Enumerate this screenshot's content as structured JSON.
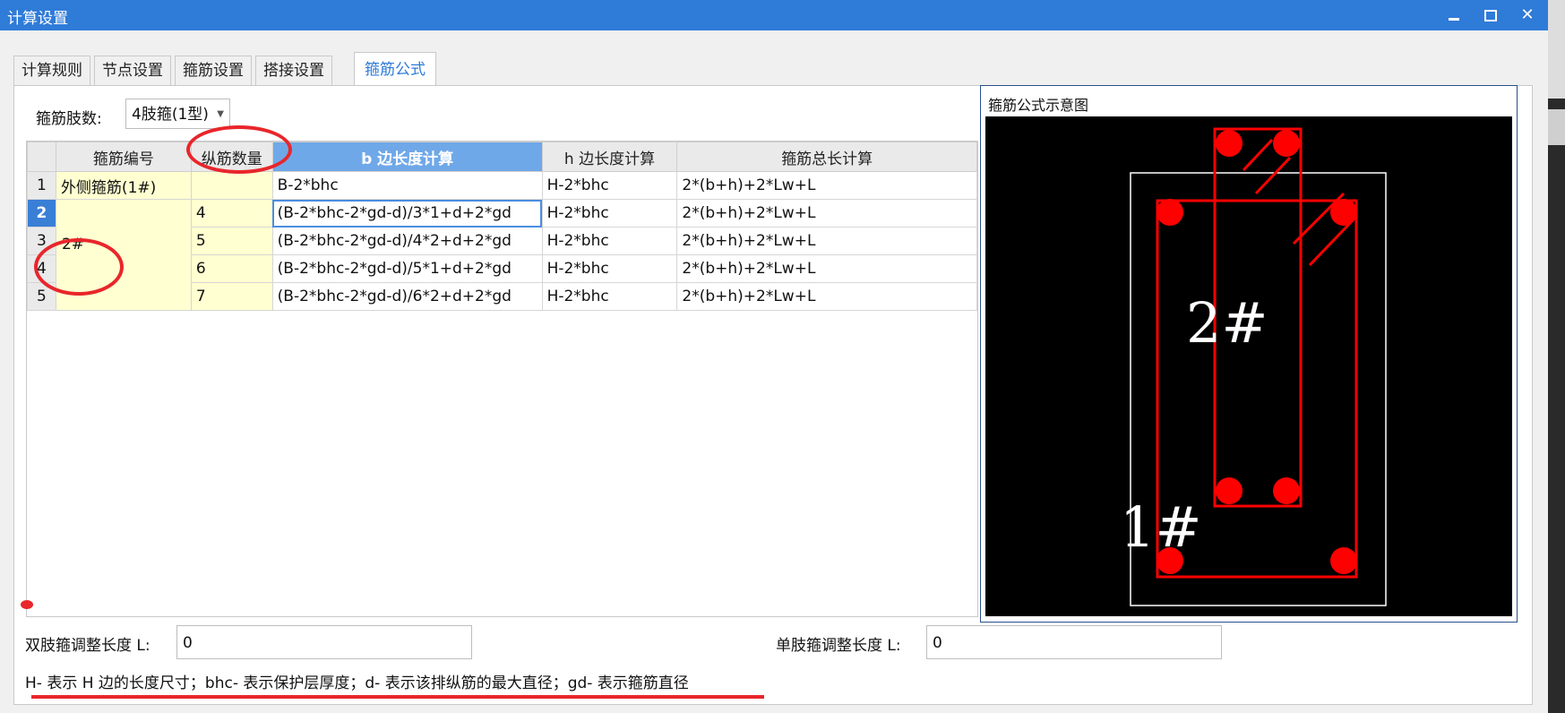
{
  "window": {
    "title": "计算设置"
  },
  "tabs": [
    "计算规则",
    "节点设置",
    "箍筋设置",
    "搭接设置",
    "箍筋公式"
  ],
  "active_tab_index": 4,
  "stirrup_count": {
    "label": "箍筋肢数:",
    "value": "4肢箍(1型)"
  },
  "table": {
    "headers": [
      "箍筋编号",
      "纵筋数量",
      "b 边长度计算",
      "h 边长度计算",
      "箍筋总长计算"
    ],
    "selected_header_index": 2,
    "rows": [
      {
        "num": "1",
        "id": "外侧箍筋(1#)",
        "count": "",
        "b": "B-2*bhc",
        "h": "H-2*bhc",
        "total": "2*(b+h)+2*Lw+L"
      },
      {
        "num": "2",
        "id": "",
        "count": "4",
        "b": "(B-2*bhc-2*gd-d)/3*1+d+2*gd",
        "h": "H-2*bhc",
        "total": "2*(b+h)+2*Lw+L"
      },
      {
        "num": "3",
        "id": "",
        "count": "5",
        "b": "(B-2*bhc-2*gd-d)/4*2+d+2*gd",
        "h": "H-2*bhc",
        "total": "2*(b+h)+2*Lw+L"
      },
      {
        "num": "4",
        "id": "",
        "count": "6",
        "b": "(B-2*bhc-2*gd-d)/5*1+d+2*gd",
        "h": "H-2*bhc",
        "total": "2*(b+h)+2*Lw+L"
      },
      {
        "num": "5",
        "id": "",
        "count": "7",
        "b": "(B-2*bhc-2*gd-d)/6*2+d+2*gd",
        "h": "H-2*bhc",
        "total": "2*(b+h)+2*Lw+L"
      }
    ],
    "merged_id_label": "2#",
    "active_row": "2"
  },
  "diagram": {
    "title": "箍筋公式示意图",
    "label_inner": "2#",
    "label_outer": "1#"
  },
  "bottom": {
    "double_label": "双肢箍调整长度 L:",
    "double_value": "0",
    "single_label": "单肢箍调整长度 L:",
    "single_value": "0"
  },
  "legend": "H- 表示 H 边的长度尺寸；bhc- 表示保护层厚度；d- 表示该排纵筋的最大直径；gd- 表示箍筋直径",
  "colors": {
    "titlebar": "#2f7bd8",
    "accent": "#2f7bd8",
    "annotation": "#e8262b",
    "highlight_cell": "#ffffd1"
  }
}
